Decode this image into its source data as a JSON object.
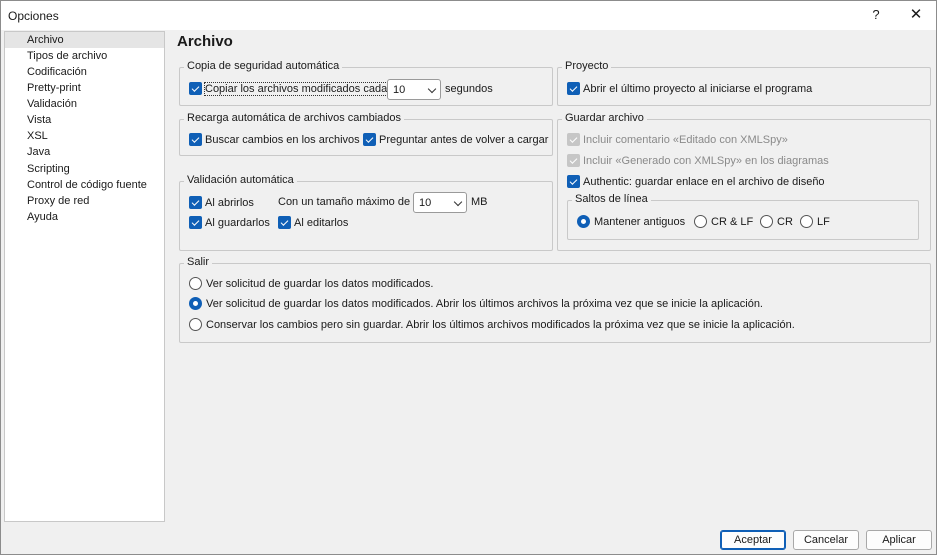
{
  "window": {
    "title": "Opciones",
    "help_glyph": "?",
    "close_glyph": "✕"
  },
  "nav": {
    "items": [
      "Archivo",
      "Tipos de archivo",
      "Codificación",
      "Pretty-print",
      "Validación",
      "Vista",
      "XSL",
      "Java",
      "Scripting",
      "Control de código fuente",
      "Proxy de red",
      "Ayuda"
    ],
    "selected": "Archivo"
  },
  "page_title": "Archivo",
  "autosave": {
    "title": "Copia de seguridad automática",
    "copy_label": "Copiar los archivos modificados cada",
    "copy_checked": true,
    "interval_value": "10",
    "interval_unit": "segundos"
  },
  "reload": {
    "title": "Recarga automática de archivos cambiados",
    "search_label": "Buscar cambios en los archivos",
    "ask_label": "Preguntar antes de volver a cargar"
  },
  "autovalidation": {
    "title": "Validación automática",
    "on_open_label": "Al abrirlos",
    "max_size_label": "Con un tamaño máximo de",
    "max_size_value": "10",
    "max_size_unit": "MB",
    "on_save_label": "Al guardarlos",
    "on_edit_label": "Al editarlos"
  },
  "project": {
    "title": "Proyecto",
    "open_last_label": "Abrir el último proyecto al iniciarse el programa"
  },
  "save_file": {
    "title": "Guardar archivo",
    "edited_comment_label": "Incluir comentario «Editado con XMLSpy»",
    "generated_label": "Incluir «Generado con XMLSpy» en los diagramas",
    "authentic_label": "Authentic: guardar enlace en el archivo de diseño"
  },
  "line_breaks": {
    "title": "Saltos de línea",
    "options": [
      "Mantener antiguos",
      "CR & LF",
      "CR",
      "LF"
    ],
    "selected": "Mantener antiguos"
  },
  "exit": {
    "title": "Salir",
    "options": [
      "Ver solicitud de guardar los datos modificados.",
      "Ver solicitud de guardar los datos modificados. Abrir los últimos archivos la próxima vez que se inicie la aplicación.",
      "Conservar los cambios pero sin guardar. Abrir los últimos archivos modificados la próxima vez que se inicie la aplicación."
    ],
    "selected_index": 1
  },
  "buttons": {
    "ok": "Aceptar",
    "cancel": "Cancelar",
    "apply": "Aplicar"
  },
  "colors": {
    "accent": "#0f5fb6",
    "disabled": "#8a8a8a"
  }
}
